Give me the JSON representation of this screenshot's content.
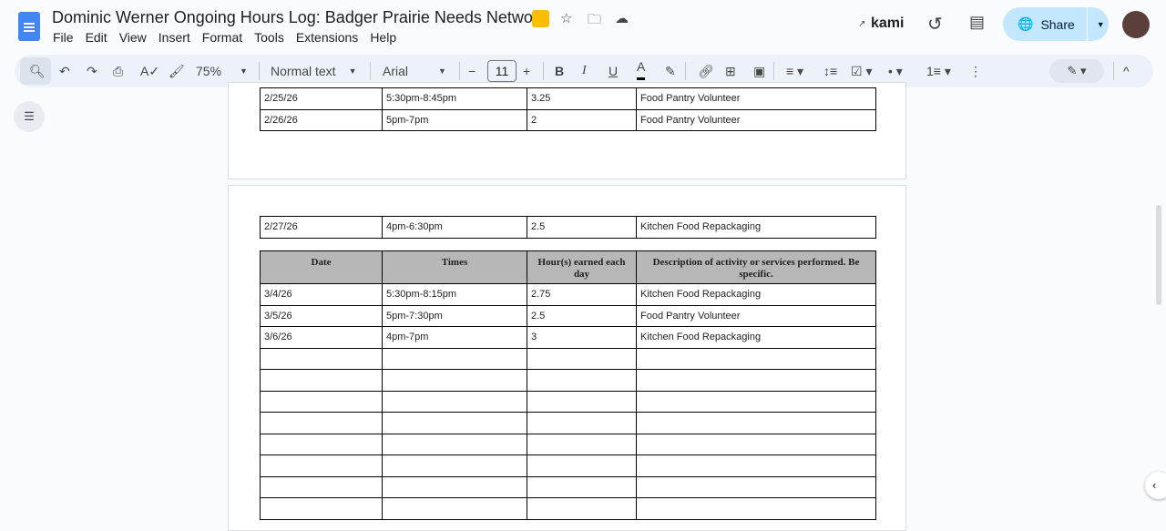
{
  "doc": {
    "title": "Dominic Werner Ongoing Hours Log: Badger Prairie Needs Network"
  },
  "menu": [
    "File",
    "Edit",
    "View",
    "Insert",
    "Format",
    "Tools",
    "Extensions",
    "Help"
  ],
  "header": {
    "kami": "kami",
    "share": "Share"
  },
  "toolbar": {
    "zoom": "75%",
    "style": "Normal text",
    "font": "Arial",
    "size": "11"
  },
  "page1_rows": [
    [
      "2/25/26",
      "5:30pm-8:45pm",
      "3.25",
      "Food Pantry Volunteer"
    ],
    [
      "2/26/26",
      "5pm-7pm",
      "2",
      "Food Pantry Volunteer"
    ]
  ],
  "page2_first": [
    "2/27/26",
    "4pm-6:30pm",
    "2.5",
    "Kitchen Food Repackaging"
  ],
  "headers": [
    "Date",
    "Times",
    "Hour(s) earned each day",
    "Description of activity or services performed. Be specific."
  ],
  "rows": [
    [
      "3/4/26",
      "5:30pm-8:15pm",
      "2.75",
      "Kitchen Food Repackaging"
    ],
    [
      "3/5/26",
      "5pm-7:30pm",
      "2.5",
      "Food Pantry Volunteer"
    ],
    [
      "3/6/26",
      "4pm-7pm",
      "3",
      "Kitchen Food Repackaging"
    ]
  ]
}
